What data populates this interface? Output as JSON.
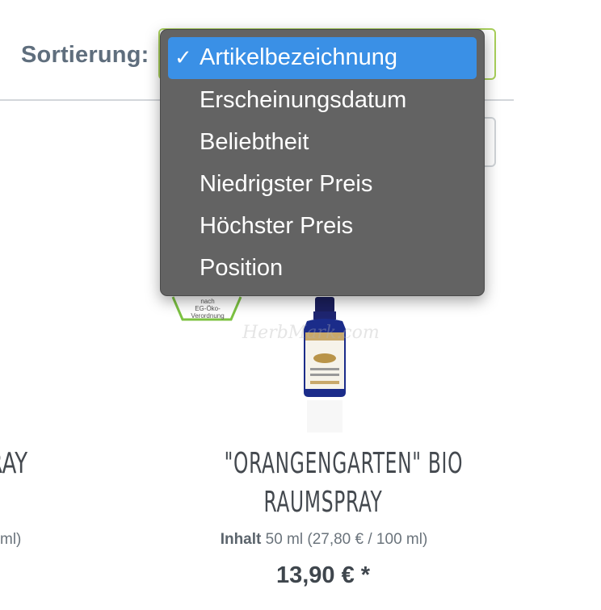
{
  "sort": {
    "label": "Sortierung:",
    "selected": "Artikelbezeichnung",
    "check_mark": "✓",
    "options": [
      {
        "label": "Artikelbezeichnung",
        "selected": true
      },
      {
        "label": "Erscheinungsdatum",
        "selected": false
      },
      {
        "label": "Beliebtheit",
        "selected": false
      },
      {
        "label": "Niedrigster Preis",
        "selected": false
      },
      {
        "label": "Höchster Preis",
        "selected": false
      },
      {
        "label": "Position",
        "selected": false
      }
    ]
  },
  "products": [
    {
      "title_partial": "PRAY",
      "content_partial": "ml)"
    },
    {
      "title_line1": "\"ORANGENGARTEN\" BIO",
      "title_line2": "RAUMSPRAY",
      "content_label": "Inhalt",
      "content_value": "50 ml (27,80 € / 100 ml)",
      "price": "13,90 € *",
      "badge_line1": "nach",
      "badge_line2": "EG-Öko-Verordnung",
      "watermark": "HerbMark.com"
    }
  ],
  "colors": {
    "accent_select_border": "#a8cf5a",
    "dropdown_bg": "#636363",
    "selection_blue": "#3a90e6",
    "label_gray": "#5f6e7d"
  }
}
